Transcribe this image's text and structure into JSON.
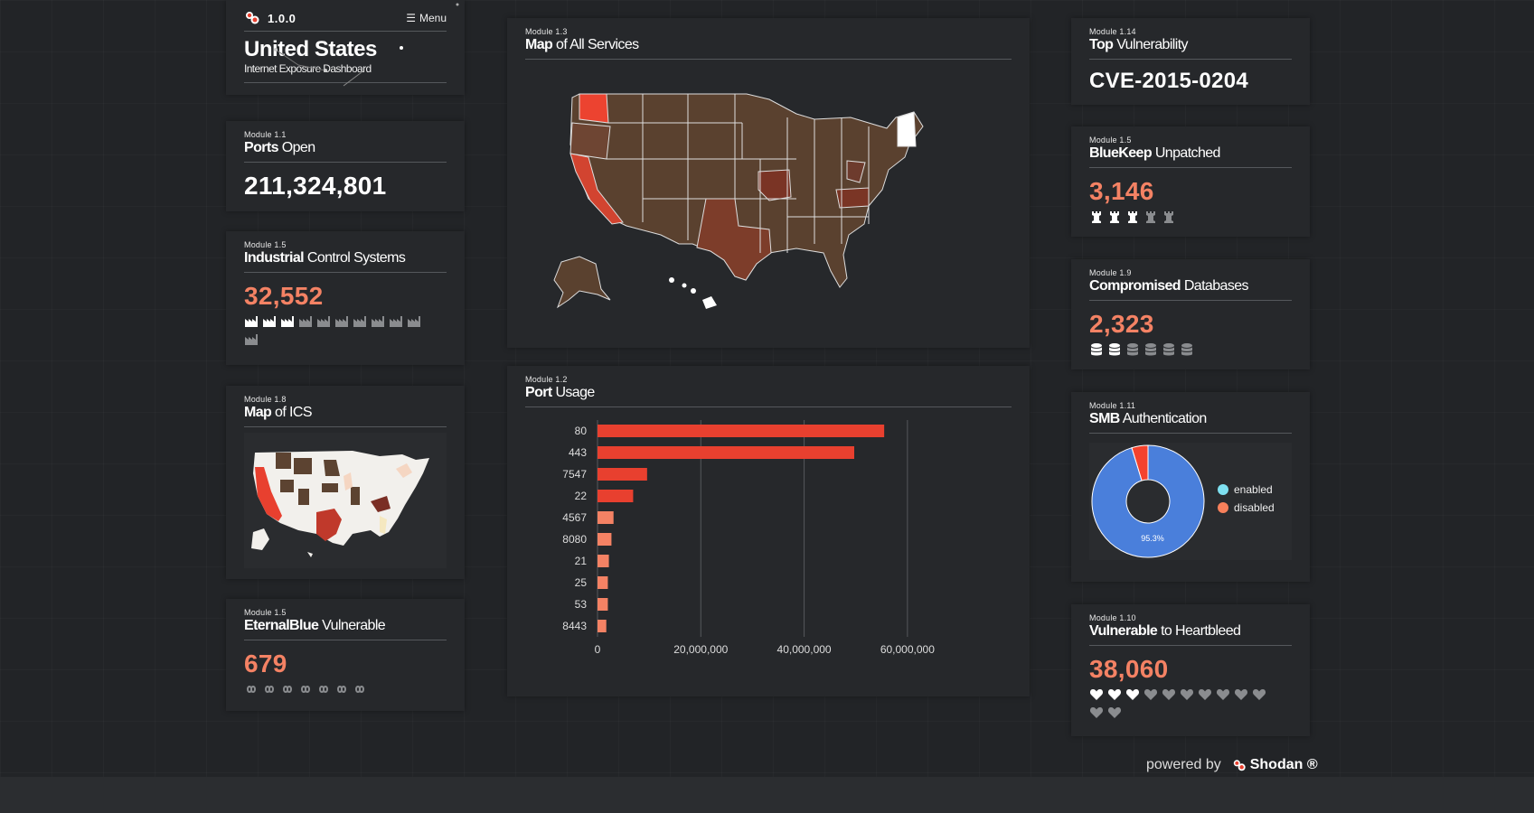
{
  "header": {
    "version": "1.0.0",
    "menu_label": "Menu",
    "country": "United States",
    "subtitle": "Internet Exposure Dashboard"
  },
  "modules": {
    "ports_open": {
      "id": "Module 1.1",
      "title_bold": "Ports",
      "title_rest": " Open",
      "value": "211,324,801"
    },
    "ics": {
      "id": "Module 1.5",
      "title_bold": "Industrial",
      "title_rest": " Control Systems",
      "value": "32,552",
      "icon": "factory-icon",
      "filled": 3,
      "total": 11
    },
    "map_ics": {
      "id": "Module 1.8",
      "title_bold": "Map",
      "title_rest": " of ICS"
    },
    "eternalblue": {
      "id": "Module 1.5",
      "title_bold": "EternalBlue",
      "title_rest": " Vulnerable",
      "value": "679",
      "icon": "infinity-icon",
      "filled": 0,
      "total": 7
    },
    "map_services": {
      "id": "Module 1.3",
      "title_bold": "Map",
      "title_rest": " of All Services"
    },
    "port_usage": {
      "id": "Module 1.2",
      "title_bold": "Port",
      "title_rest": " Usage"
    },
    "top_vuln": {
      "id": "Module 1.14",
      "title_bold": "Top",
      "title_rest": " Vulnerability",
      "value": "CVE-2015-0204"
    },
    "bluekeep": {
      "id": "Module 1.5",
      "title_bold": "BlueKeep",
      "title_rest": " Unpatched",
      "value": "3,146",
      "icon": "chess-rook-icon",
      "filled": 3,
      "total": 5
    },
    "compromised_db": {
      "id": "Module 1.9",
      "title_bold": "Compromised",
      "title_rest": " Databases",
      "value": "2,323",
      "icon": "database-icon",
      "filled": 2,
      "total": 6
    },
    "smb": {
      "id": "Module 1.11",
      "title_bold": "SMB",
      "title_rest": " Authentication",
      "slice_label": "95.3%"
    },
    "heartbleed": {
      "id": "Module 1.10",
      "title_bold": "Vulnerable",
      "title_rest": " to Heartbleed",
      "value": "38,060",
      "icon": "heart-icon",
      "filled": 3,
      "total": 12
    }
  },
  "chart_data": [
    {
      "type": "bar",
      "orientation": "horizontal",
      "categories": [
        "80",
        "443",
        "7547",
        "22",
        "4567",
        "8080",
        "21",
        "25",
        "53",
        "8443"
      ],
      "values": [
        55500000,
        49700000,
        9600000,
        6900000,
        3100000,
        2700000,
        2200000,
        2000000,
        2000000,
        1700000
      ],
      "xlim": [
        0,
        70000000
      ],
      "x_ticks": [
        "0",
        "20,000,000",
        "40,000,000",
        "60,000,000"
      ],
      "x_tick_values": [
        0,
        20000000,
        40000000,
        60000000
      ],
      "grid": true,
      "colors": {
        "top": "#e8402f",
        "rest": "#f48264"
      }
    },
    {
      "type": "pie",
      "labels": [
        "enabled",
        "disabled"
      ],
      "values": [
        95.3,
        4.7
      ],
      "colors": [
        "#4a7fdb",
        "#f4422d"
      ],
      "legend": [
        {
          "label": "enabled",
          "color": "#7ee0f0"
        },
        {
          "label": "disabled",
          "color": "#f7805b"
        }
      ],
      "legend_position": "right"
    }
  ],
  "footer": {
    "powered_by": "powered by",
    "brand": "Shodan ®"
  },
  "colors": {
    "background": "#222427",
    "card": "#26282b",
    "salmon": "#f48264",
    "accent_red": "#e8402f"
  }
}
